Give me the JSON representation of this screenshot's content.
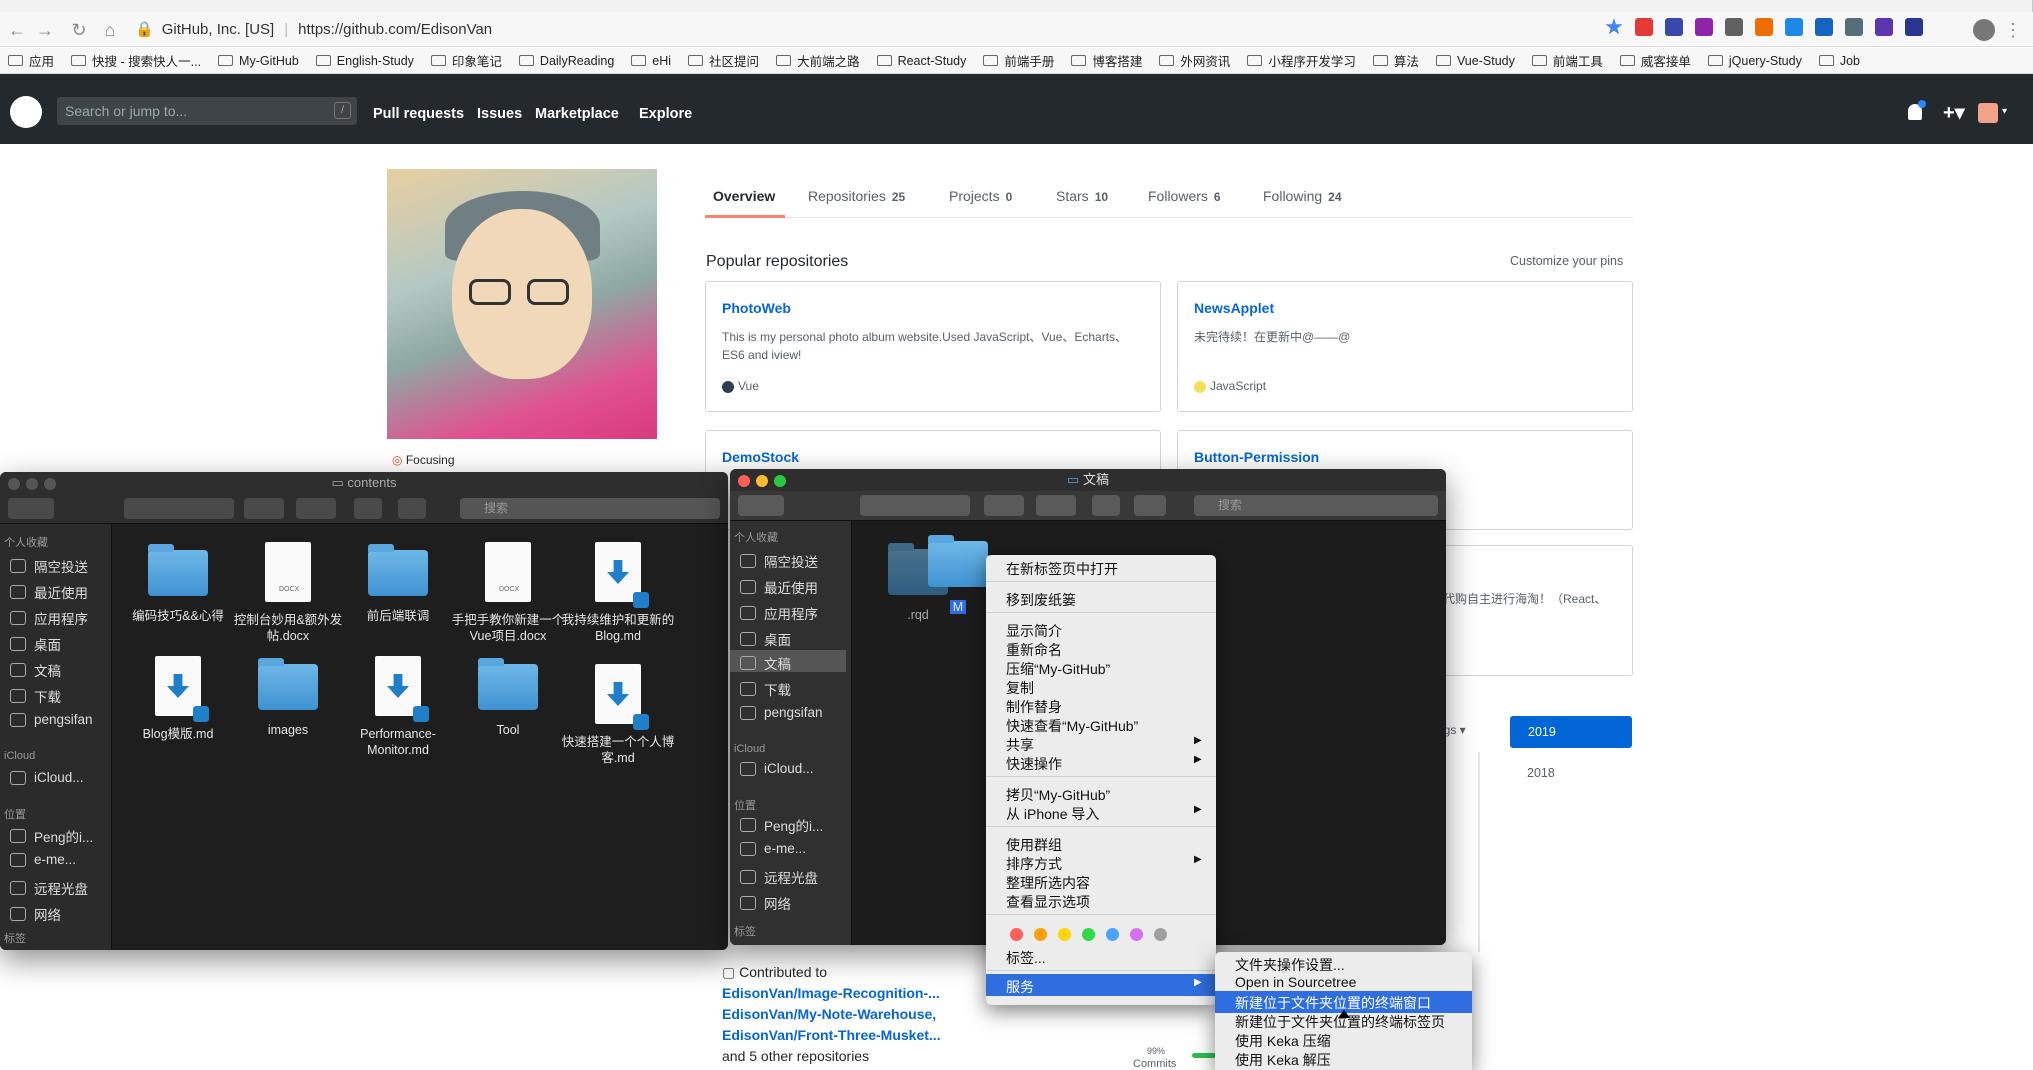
{
  "browser": {
    "url_org": "GitHub, Inc. [US]",
    "url_text": "https://github.com/EdisonVan",
    "bookmarks": [
      "应用",
      "快搜 - 搜索快人一...",
      "My-GitHub",
      "English-Study",
      "印象笔记",
      "DailyReading",
      "eHi",
      "社区提问",
      "大前端之路",
      "React-Study",
      "前端手册",
      "博客搭建",
      "外网资讯",
      "小程序开发学习",
      "算法",
      "Vue-Study",
      "前端工具",
      "威客接单",
      "jQuery-Study",
      "Job"
    ]
  },
  "github": {
    "search_placeholder": "Search or jump to...",
    "search_key": "/",
    "nav": [
      "Pull requests",
      "Issues",
      "Marketplace",
      "Explore"
    ],
    "status": "Focusing",
    "tabs": [
      {
        "label": "Overview",
        "count": ""
      },
      {
        "label": "Repositories",
        "count": "25"
      },
      {
        "label": "Projects",
        "count": "0"
      },
      {
        "label": "Stars",
        "count": "10"
      },
      {
        "label": "Followers",
        "count": "6"
      },
      {
        "label": "Following",
        "count": "24"
      }
    ],
    "popular_title": "Popular repositories",
    "customize": "Customize your pins",
    "repos": [
      {
        "name": "PhotoWeb",
        "desc": "This is my personal photo album website.Used JavaScript、Vue、Echarts、ES6 and iview!",
        "lang": "Vue",
        "lang_color": "#2c3e50"
      },
      {
        "name": "NewsApplet",
        "desc": "未完待续！在更新中@——@",
        "lang": "JavaScript",
        "lang_color": "#f1e05a"
      },
      {
        "name": "DemoStock",
        "desc": "",
        "lang": "",
        "lang_color": ""
      },
      {
        "name": "Button-Permission",
        "desc": "",
        "lang": "",
        "lang_color": ""
      }
    ],
    "partial_desc": "代购自主进行海淘！（React、",
    "settings_hint": "ngs ▾",
    "years": [
      "2019",
      "2018"
    ],
    "contributed_label": "Contributed to",
    "contributed": [
      "EdisonVan/Image-Recognition-...",
      "EdisonVan/My-Note-Warehouse,",
      "EdisonVan/Front-Three-Musket..."
    ],
    "other_repos": "and 5 other repositories",
    "commits_pct": "99%",
    "commits_label": "Commits"
  },
  "finder_left": {
    "title": "contents",
    "search_placeholder": "搜索",
    "sidebar": {
      "favorites_label": "个人收藏",
      "favorites": [
        "隔空投送",
        "最近使用",
        "应用程序",
        "桌面",
        "文稿",
        "下载",
        "pengsifan"
      ],
      "icloud_label": "iCloud",
      "icloud": [
        "iCloud..."
      ],
      "locations_label": "位置",
      "locations": [
        "Peng的i...",
        "e-me...",
        "远程光盘",
        "网络"
      ],
      "tags_label": "标签"
    },
    "items": [
      {
        "name": "编码技巧&&心得",
        "kind": "folder"
      },
      {
        "name": "控制台妙用&额外发帖.docx",
        "kind": "docx"
      },
      {
        "name": "前后端联调",
        "kind": "folder"
      },
      {
        "name": "手把手教你新建一个Vue项目.docx",
        "kind": "docx"
      },
      {
        "name": "我持续维护和更新的Blog.md",
        "kind": "md"
      },
      {
        "name": "Blog模版.md",
        "kind": "md"
      },
      {
        "name": "images",
        "kind": "folder"
      },
      {
        "name": "Performance-Monitor.md",
        "kind": "md"
      },
      {
        "name": "Tool",
        "kind": "folder"
      },
      {
        "name": "快速搭建一个个人博客.md",
        "kind": "md"
      }
    ]
  },
  "finder_right": {
    "title": "文稿",
    "search_placeholder": "搜索",
    "sidebar": {
      "favorites_label": "个人收藏",
      "favorites": [
        "隔空投送",
        "最近使用",
        "应用程序",
        "桌面",
        "文稿",
        "下载",
        "pengsifan"
      ],
      "icloud_label": "iCloud",
      "icloud": [
        "iCloud..."
      ],
      "locations_label": "位置",
      "locations": [
        "Peng的i...",
        "e-me...",
        "远程光盘",
        "网络"
      ],
      "tags_label": "标签"
    },
    "items": [
      {
        "name": ".rqd"
      },
      {
        "name": "M"
      }
    ]
  },
  "context_menu": {
    "items": [
      "在新标签页中打开",
      "移到废纸篓",
      "显示简介",
      "重新命名",
      "压缩“My-GitHub”",
      "复制",
      "制作替身",
      "快速查看“My-GitHub”",
      "共享",
      "快速操作",
      "拷贝“My-GitHub”",
      "从 iPhone 导入",
      "使用群组",
      "排序方式",
      "整理所选内容",
      "查看显示选项",
      "标签...",
      "服务"
    ],
    "tag_colors": [
      "#ff5f57",
      "#ff9f0a",
      "#ffd60a",
      "#32d74b",
      "#4aa3ff",
      "#d670f0",
      "#a0a0a0"
    ]
  },
  "services_menu": {
    "items": [
      "文件夹操作设置...",
      "Open in Sourcetree",
      "新建位于文件夹位置的终端窗口",
      "新建位于文件夹位置的终端标签页",
      "使用 Keka 压缩",
      "使用 Keka 解压"
    ]
  }
}
